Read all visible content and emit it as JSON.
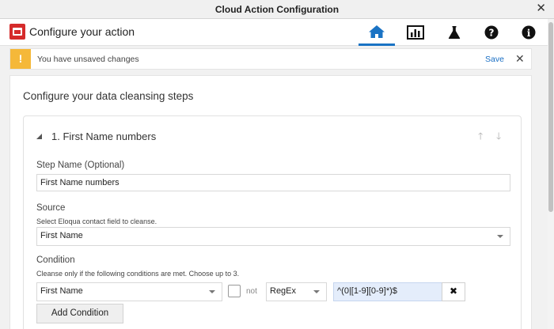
{
  "window": {
    "title": "Cloud Action Configuration"
  },
  "header": {
    "title": "Configure your action",
    "nav": [
      {
        "icon": "home-icon",
        "active": true
      },
      {
        "icon": "bar-chart-icon",
        "active": false
      },
      {
        "icon": "flask-icon",
        "active": false
      },
      {
        "icon": "help-icon",
        "active": false
      },
      {
        "icon": "info-icon",
        "active": false
      }
    ]
  },
  "banner": {
    "icon": "!",
    "message": "You have unsaved changes",
    "save_label": "Save"
  },
  "panel": {
    "title": "Configure your data cleansing steps",
    "step": {
      "title": "1. First Name numbers",
      "step_name_label": "Step Name (Optional)",
      "step_name_value": "First Name numbers",
      "source_label": "Source",
      "source_hint": "Select Eloqua contact field to cleanse.",
      "source_value": "First Name",
      "condition_label": "Condition",
      "condition_hint": "Cleanse only if the following conditions are met. Choose up to 3.",
      "condition_field": "First Name",
      "not_label": "not",
      "condition_operator": "RegEx",
      "condition_value": "^(0|[1-9][0-9]*)$",
      "add_condition_label": "Add Condition"
    }
  },
  "colors": {
    "accent": "#1a73c4",
    "warning": "#f5b839",
    "brand": "#d52b2b"
  }
}
